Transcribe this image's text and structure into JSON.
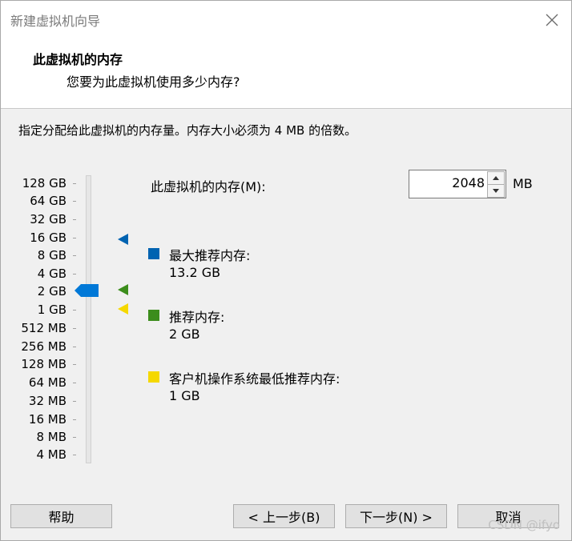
{
  "window": {
    "title": "新建虚拟机向导"
  },
  "header": {
    "title": "此虚拟机的内存",
    "subtitle": "您要为此虚拟机使用多少内存?"
  },
  "instructions": "指定分配给此虚拟机的内存量。内存大小必须为 4 MB 的倍数。",
  "scale": {
    "labels": [
      "128 GB",
      "64 GB",
      "32 GB",
      "16 GB",
      "8 GB",
      "4 GB",
      "2 GB",
      "1 GB",
      "512 MB",
      "256 MB",
      "128 MB",
      "64 MB",
      "32 MB",
      "16 MB",
      "8 MB",
      "4 MB"
    ],
    "selected": "2 GB"
  },
  "memory": {
    "label": "此虚拟机的内存(M):",
    "value": "2048",
    "unit": "MB"
  },
  "legend": {
    "max": {
      "title": "最大推荐内存:",
      "value": "13.2 GB",
      "color": "#0063b1"
    },
    "recommended": {
      "title": "推荐内存:",
      "value": "2 GB",
      "color": "#3c8d1c"
    },
    "guest_min": {
      "title": "客户机操作系统最低推荐内存:",
      "value": "1 GB",
      "color": "#f5d800"
    }
  },
  "colors": {
    "thumb": "#0078d7"
  },
  "buttons": {
    "help": "帮助",
    "back": "< 上一步(B)",
    "next": "下一步(N) >",
    "cancel": "取消"
  },
  "watermark": "CSDN @ifyo"
}
